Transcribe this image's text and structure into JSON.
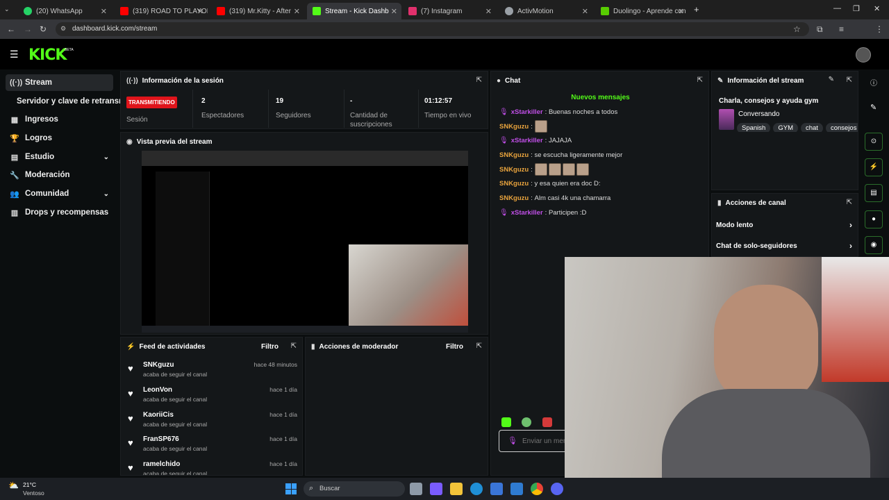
{
  "browser": {
    "tabs": [
      {
        "label": "(20) WhatsApp",
        "color": "#25d366"
      },
      {
        "label": "(319) ROAD TO PLAYOFF",
        "color": "#ff0000"
      },
      {
        "label": "(319) Mr.Kitty - After",
        "color": "#ff0000"
      },
      {
        "label": "Stream - Kick Dashb",
        "color": "#53fc18"
      },
      {
        "label": "(7) Instagram",
        "color": "#e1306c"
      },
      {
        "label": "ActivMotion",
        "color": "#9aa0a6"
      },
      {
        "label": "Duolingo - Aprende con",
        "color": "#58cc02"
      }
    ],
    "url": "dashboard.kick.com/stream"
  },
  "app": {
    "logo": "KICK",
    "beta": "BETA",
    "accent": "#53fc18"
  },
  "sidebar": {
    "items": [
      {
        "label": "Stream",
        "icon": "broadcast-icon"
      },
      {
        "label": "Servidor y clave de retransmisión",
        "icon": ""
      },
      {
        "label": "Ingresos",
        "icon": "chart-icon"
      },
      {
        "label": "Logros",
        "icon": "trophy-icon"
      },
      {
        "label": "Estudio",
        "icon": "studio-icon"
      },
      {
        "label": "Moderación",
        "icon": "wrench-icon"
      },
      {
        "label": "Comunidad",
        "icon": "people-icon"
      },
      {
        "label": "Drops y recompensas",
        "icon": "gift-icon"
      }
    ]
  },
  "session": {
    "title": "Información de la sesión",
    "live_badge": "TRANSMITIENDO",
    "live_label": "Sesión",
    "stats": [
      {
        "value": "2",
        "label": "Espectadores"
      },
      {
        "value": "19",
        "label": "Seguidores"
      },
      {
        "value": "-",
        "label": "Cantidad de suscripciones"
      },
      {
        "value": "01:12:57",
        "label": "Tiempo en vivo"
      }
    ]
  },
  "preview": {
    "title": "Vista previa del stream"
  },
  "feed": {
    "title": "Feed de actividades",
    "filter": "Filtro",
    "items": [
      {
        "user": "SNKguzu",
        "action": "acaba de seguir el canal",
        "time": "hace 48 minutos"
      },
      {
        "user": "LeonVon",
        "action": "acaba de seguir el canal",
        "time": "hace 1 día"
      },
      {
        "user": "KaoriiCis",
        "action": "acaba de seguir el canal",
        "time": "hace 1 día"
      },
      {
        "user": "FranSP676",
        "action": "acaba de seguir el canal",
        "time": "hace 1 día"
      },
      {
        "user": "ramelchido",
        "action": "acaba de seguir el canal",
        "time": "hace 1 día"
      }
    ]
  },
  "modactions": {
    "title": "Acciones de moderador",
    "filter": "Filtro"
  },
  "chat": {
    "title": "Chat",
    "new_messages": "Nuevos mensajes",
    "input_placeholder": "Enviar un mensaje",
    "messages": [
      {
        "user": "xStarkiller",
        "text": "Buenas noches a todos",
        "mic": true,
        "color": "#c14fe8"
      },
      {
        "user": "SNKguzu",
        "text": "",
        "mic": false,
        "color": "#e8a33d",
        "emotes": 1
      },
      {
        "user": "xStarkiller",
        "text": "JAJAJA",
        "mic": true,
        "color": "#c14fe8"
      },
      {
        "user": "SNKguzu",
        "text": "se escucha ligeramente mejor",
        "mic": false,
        "color": "#e8a33d"
      },
      {
        "user": "SNKguzu",
        "text": "",
        "mic": false,
        "color": "#e8a33d",
        "emotes": 4
      },
      {
        "user": "SNKguzu",
        "text": "y esa quien era doc D:",
        "mic": false,
        "color": "#e8a33d"
      },
      {
        "user": "SNKguzu",
        "text": "Alm casi 4k una chamarra",
        "mic": false,
        "color": "#e8a33d"
      },
      {
        "user": "xStarkiller",
        "text": "Participen :D",
        "mic": true,
        "color": "#c14fe8"
      }
    ]
  },
  "stream_info": {
    "title": "Información del stream",
    "stream_title": "Charla, consejos y ayuda gym",
    "category": "Conversando",
    "tags": [
      "Spanish",
      "GYM",
      "chat",
      "consejos"
    ]
  },
  "channel_actions": {
    "title": "Acciones de canal",
    "items": [
      "Modo lento",
      "Chat de solo-seguidores"
    ]
  },
  "taskbar": {
    "weather_temp": "21°C",
    "weather_desc": "Ventoso",
    "search": "Buscar"
  }
}
